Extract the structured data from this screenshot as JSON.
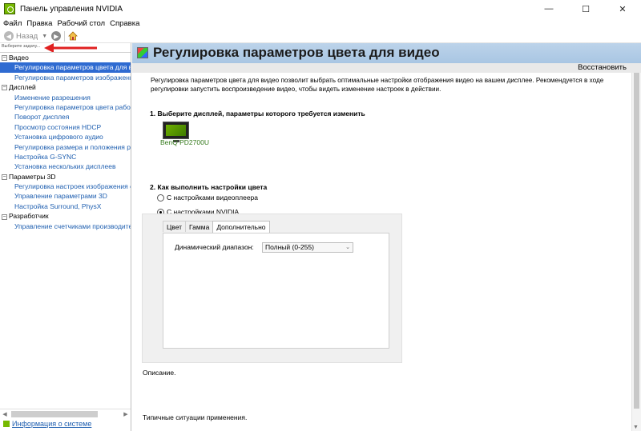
{
  "window": {
    "title": "Панель управления NVIDIA",
    "minimize_glyph": "—",
    "maximize_glyph": "☐",
    "close_glyph": "✕"
  },
  "menu": [
    {
      "label": "Файл"
    },
    {
      "label": "Правка"
    },
    {
      "label": "Рабочий стол"
    },
    {
      "label": "Справка"
    }
  ],
  "toolbar": {
    "back_label": "Назад",
    "back_icon": "arrow-left-icon",
    "forward_icon": "arrow-right-icon",
    "home_icon": "home-icon"
  },
  "left": {
    "task_label": "Выберите задачу...",
    "tree": [
      {
        "type": "cat",
        "label": "Видео",
        "expander": "−"
      },
      {
        "type": "item",
        "label": "Регулировка параметров цвета для видео",
        "selected": true
      },
      {
        "type": "item",
        "label": "Регулировка параметров изображения для видео"
      },
      {
        "type": "cat",
        "label": "Дисплей",
        "expander": "−"
      },
      {
        "type": "item",
        "label": "Изменение разрешения"
      },
      {
        "type": "item",
        "label": "Регулировка параметров цвета рабочего стола"
      },
      {
        "type": "item",
        "label": "Поворот дисплея"
      },
      {
        "type": "item",
        "label": "Просмотр состояния HDCP"
      },
      {
        "type": "item",
        "label": "Установка цифрового аудио"
      },
      {
        "type": "item",
        "label": "Регулировка размера и положения рабочего стола"
      },
      {
        "type": "item",
        "label": "Настройка G-SYNC"
      },
      {
        "type": "item",
        "label": "Установка нескольких дисплеев"
      },
      {
        "type": "cat",
        "label": "Параметры 3D",
        "expander": "−"
      },
      {
        "type": "item",
        "label": "Регулировка настроек изображения с просмотром"
      },
      {
        "type": "item",
        "label": "Управление параметрами 3D"
      },
      {
        "type": "item",
        "label": "Настройка Surround, PhysX"
      },
      {
        "type": "cat",
        "label": "Разработчик",
        "expander": "−"
      },
      {
        "type": "item",
        "label": "Управление счетчиками производительности"
      }
    ],
    "system_info": "Информация о системе"
  },
  "main": {
    "title": "Регулировка параметров цвета для видео",
    "restore": "Восстановить",
    "description": "Регулировка параметров цвета для видео позволит выбрать оптимальные настройки отображения видео на вашем дисплее. Рекомендуется в ходе регулировки запустить воспроизведение видео, чтобы видеть изменение настроек в действии.",
    "section1": "1. Выберите дисплей, параметры которого требуется изменить",
    "display_name": "BenQ PD2700U",
    "section2": "2. Как выполнить настройки цвета",
    "radio_player": "С настройками видеоплеера",
    "radio_nvidia": "С настройками NVIDIA",
    "selected_radio": "nvidia",
    "tabs": [
      {
        "label": "Цвет"
      },
      {
        "label": "Гамма"
      },
      {
        "label": "Дополнительно",
        "active": true
      }
    ],
    "dynamic_range_label": "Динамический диапазон:",
    "dynamic_range_value": "Полный (0-255)",
    "description_label": "Описание.",
    "typical_usage_label": "Типичные ситуации применения."
  },
  "colors": {
    "accent_selected": "#2f6bd1",
    "link": "#1f5fb0",
    "nvidia_green": "#76b900",
    "header_band": "#bcd3ea",
    "annotation_arrow": "#e02020"
  }
}
